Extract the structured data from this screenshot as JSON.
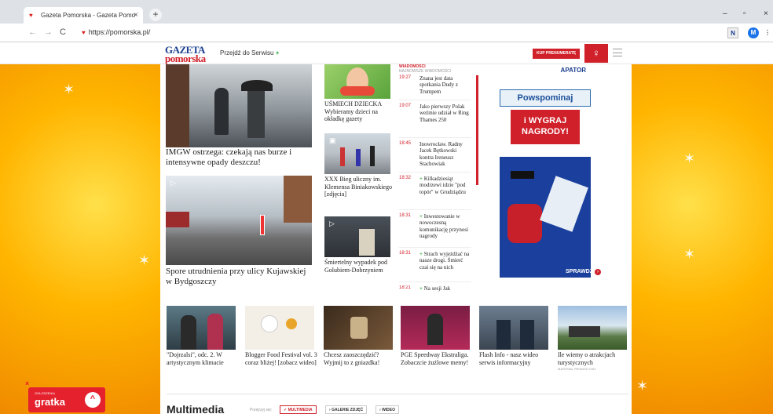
{
  "browser": {
    "tab_title": "Gazeta Pomorska - Gazeta Pomo",
    "tab_close": "×",
    "new_tab": "+",
    "url": "https://pomorska.pl/",
    "back": "←",
    "forward": "→",
    "reload": "C",
    "ext1": "N",
    "profile": "M",
    "menu": "⋮",
    "minimize": "–",
    "maximize": "▫",
    "close": "×"
  },
  "header": {
    "logo_line1": "GAZETA",
    "logo_line2": "pomorska",
    "goto_label": "Przejdź do Serwisu",
    "goto_plus": "+",
    "subscribe_label": "KUP PRENUMERATĘ",
    "user_icon": "♀"
  },
  "main_articles": [
    {
      "caption": "IMGW ostrzega: czekają nas burze i intensywne opady deszczu!"
    },
    {
      "caption": "Spore utrudnienia przy ulicy Kujawskiej w Bydgoszczy"
    }
  ],
  "mid_articles": [
    {
      "caption": "UŚMIECH DZIECKA Wybieramy dzieci na okładkę gazety"
    },
    {
      "caption": "XXX Bieg uliczny im. Klemensa Biniakowskiego [zdjęcia]"
    },
    {
      "caption": "Śmiertelny wypadek pod Golubiem-Dobrzyniem"
    }
  ],
  "news": {
    "header_top": "WIADOMOŚCI",
    "header_sub": "NAJNOWSZE WIADOMOŚCI",
    "items": [
      {
        "time": "19:27",
        "plus": "",
        "text": "Znana jest data spotkania Dudy z Trumpem"
      },
      {
        "time": "19:07",
        "plus": "",
        "text": "Jako pierwszy Polak weźmie udział w Ring Thames 250"
      },
      {
        "time": "18:45",
        "plus": "",
        "text": "Inowrocław. Radny Jacek Bętkowski kontra Ireneusz Stachowiak"
      },
      {
        "time": "18:32",
        "plus": "+",
        "text": "Kilkadziesiąt modrzewi idzie \"pod topór\" w Grudziądzu"
      },
      {
        "time": "18:31",
        "plus": "+",
        "text": "Inwestowanie w nowoczesną komunikację przynosi nagrody"
      },
      {
        "time": "18:31",
        "plus": "+",
        "text": "Strach wyjeżdżać na nasze drogi. Śmierć czai się na nich"
      },
      {
        "time": "18:21",
        "plus": "+",
        "text": "Na sesji Jak"
      }
    ]
  },
  "ad": {
    "brand": "APATOR",
    "line1": "Powspominaj",
    "line2": "i WYGRAJ NAGRODY!",
    "cta": "SPRAWDŹ",
    "cta_arrow": "›"
  },
  "thumbs": [
    {
      "caption": "\"Dojrzalsi\", odc. 2. W artystycznym klimacie",
      "note": ""
    },
    {
      "caption": "Blogger Food Festival vol. 3 coraz bliżej! [zobacz wideo]",
      "note": ""
    },
    {
      "caption": "Chcesz zaoszczędzić? Wyjmij to z gniazdka!",
      "note": ""
    },
    {
      "caption": "PGE Speedway Ekstraliga. Zobaczcie żużlowe memy!",
      "note": ""
    },
    {
      "caption": "Flash Info - nasz wideo serwis informacyjny",
      "note": ""
    },
    {
      "caption": "Ile wiemy o atrakcjach turystycznych",
      "note": "MATERIAŁ PROMOCYJNY"
    }
  ],
  "multimedia": {
    "title": "Multimedia",
    "label": "Przejrzyj się:",
    "tabs": [
      "MULTIMEDIA",
      "GALERIE ZDJĘĆ",
      "WIDEO"
    ]
  },
  "gratka": {
    "small": "OGŁOSZENIA",
    "big": "gratka",
    "close": "×",
    "up": "^"
  }
}
